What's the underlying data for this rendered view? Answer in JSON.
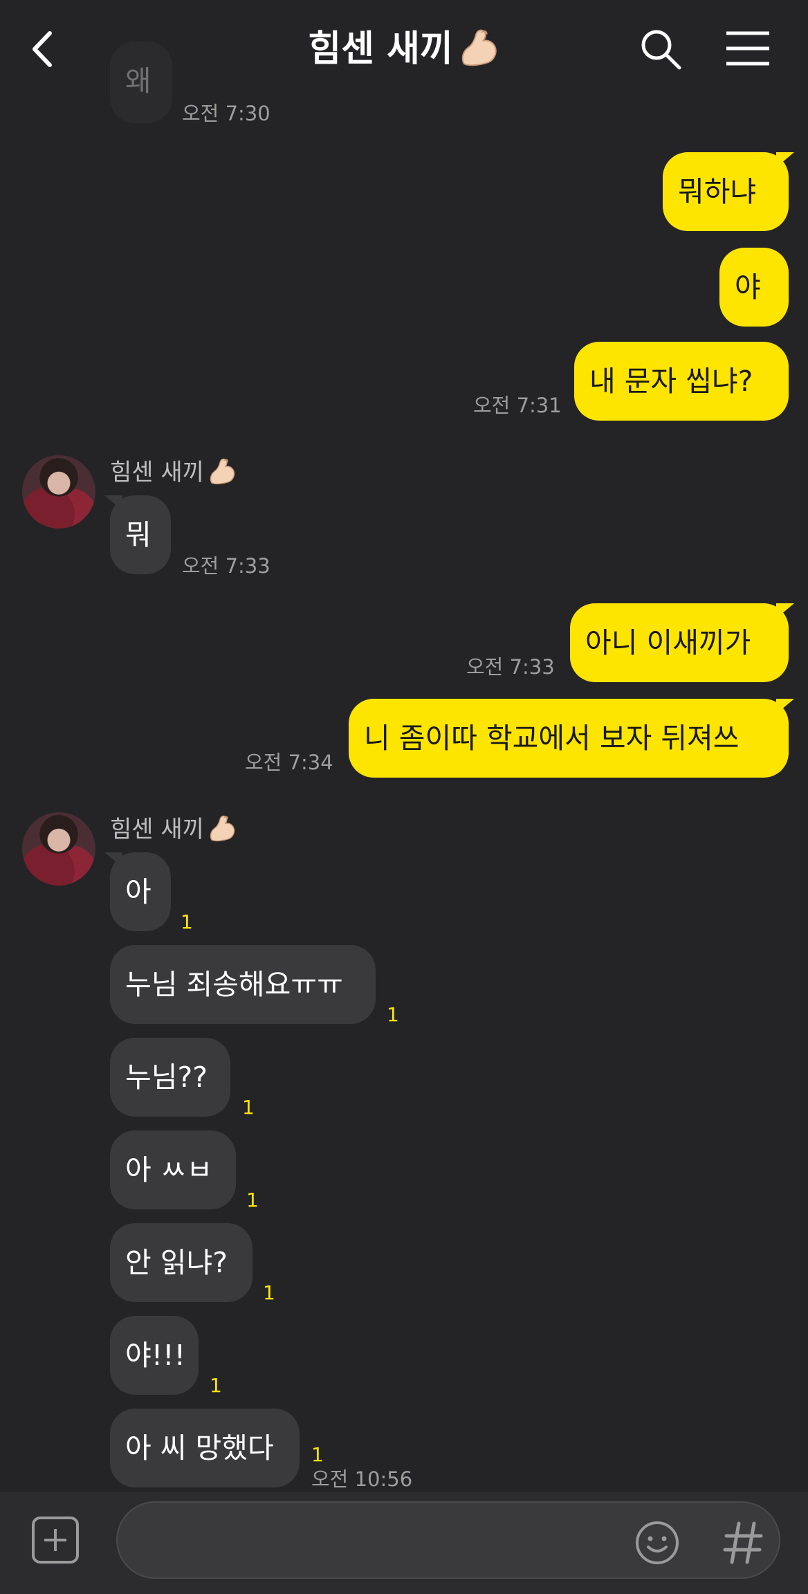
{
  "header": {
    "title": "힘센 새끼",
    "back_icon": "chevron-left-icon",
    "search_icon": "search-icon",
    "menu_icon": "hamburger-menu-icon"
  },
  "colors": {
    "background": "#242426",
    "my_bubble": "#fee500",
    "their_bubble": "#3a3a3d",
    "unread_count": "#fee500"
  },
  "messages": {
    "top_partial": {
      "text": "왜",
      "time": "오전 7:30"
    },
    "out1": [
      {
        "text": "뭐하냐"
      },
      {
        "text": "야"
      },
      {
        "text": "내 문자 씹냐?",
        "time": "오전 7:31"
      }
    ],
    "in1": {
      "sender": "힘센 새끼",
      "text": "뭐",
      "time": "오전 7:33"
    },
    "out2": [
      {
        "text": "아니 이새끼가",
        "time": "오전 7:33"
      },
      {
        "text": "니 좀이따 학교에서 보자 뒤져쓰",
        "time": "오전 7:34"
      }
    ],
    "in2": {
      "sender": "힘센 새끼",
      "items": [
        {
          "text": "아",
          "unread": "1"
        },
        {
          "text": "누님 죄송해요ㅠㅠ",
          "unread": "1"
        },
        {
          "text": "누님??",
          "unread": "1"
        },
        {
          "text": "아 ㅆㅂ",
          "unread": "1"
        },
        {
          "text": "안 읽냐?",
          "unread": "1"
        },
        {
          "text": "야!!!",
          "unread": "1"
        },
        {
          "text": "아 씨 망했다",
          "unread": "1",
          "time": "오전 10:56"
        }
      ]
    }
  },
  "input": {
    "placeholder": "",
    "plus_icon": "plus-icon",
    "emoji_icon": "emoji-icon",
    "hash_icon": "hash-icon"
  }
}
